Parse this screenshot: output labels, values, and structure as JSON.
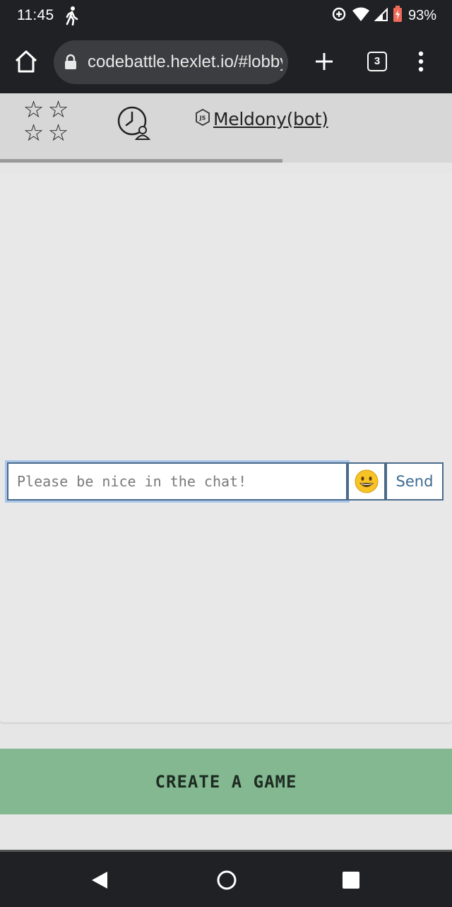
{
  "status_bar": {
    "time": "11:45",
    "battery_text": "93%",
    "icons": [
      "walk-icon",
      "data-saver-icon",
      "wifi-icon",
      "signal-icon",
      "battery-icon"
    ]
  },
  "browser": {
    "url": "codebattle.hexlet.io/#lobby",
    "tab_count": "3",
    "icons": [
      "home-icon",
      "lock-icon",
      "plus-icon",
      "tabs-icon",
      "menu-icon"
    ]
  },
  "game_header": {
    "stars_icon": "stars-rating-icon",
    "clock_icon": "timer-user-icon",
    "language_icon": "nodejs-icon",
    "player_name": "Meldony(bot)",
    "progress": 0.625
  },
  "chat": {
    "input_value": "",
    "input_placeholder": "Please be nice in the chat!",
    "emoji": "😀",
    "send_label": "Send"
  },
  "actions": {
    "create_game_label": "CREATE A GAME"
  },
  "colors": {
    "create_button_bg": "#83b890",
    "chat_border": "#4a6a8a",
    "chat_focus_ring": "#a9c6e8"
  }
}
